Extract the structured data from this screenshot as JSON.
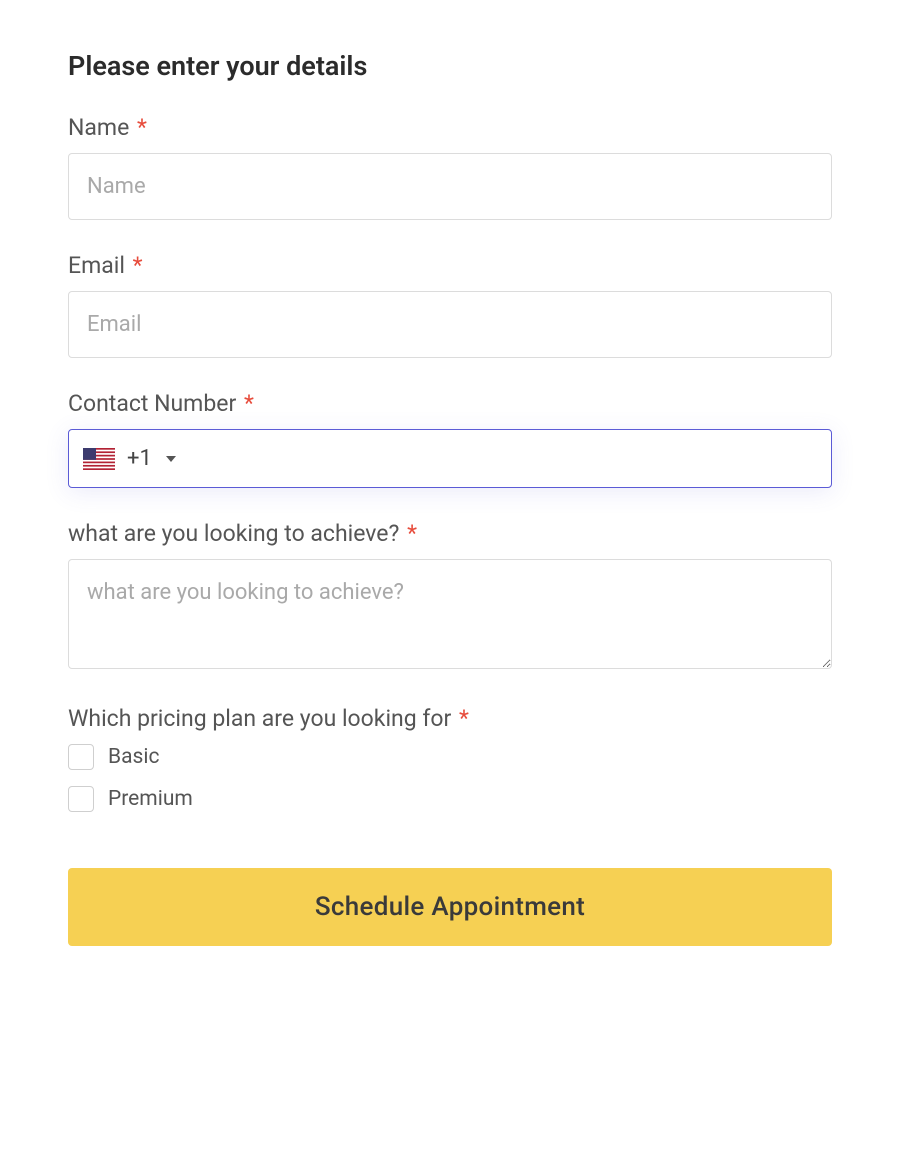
{
  "form": {
    "title": "Please enter your details",
    "name": {
      "label": "Name",
      "placeholder": "Name",
      "value": ""
    },
    "email": {
      "label": "Email",
      "placeholder": "Email",
      "value": ""
    },
    "contact": {
      "label": "Contact Number",
      "dial_code": "+1",
      "flag": "us",
      "value": ""
    },
    "achieve": {
      "label": "what are you looking to achieve?",
      "placeholder": "what are you looking to achieve?",
      "value": ""
    },
    "pricing": {
      "label": "Which pricing plan are you looking for",
      "options": [
        {
          "label": "Basic",
          "checked": false
        },
        {
          "label": "Premium",
          "checked": false
        }
      ]
    },
    "submit_label": "Schedule Appointment",
    "required_marker": "*"
  }
}
